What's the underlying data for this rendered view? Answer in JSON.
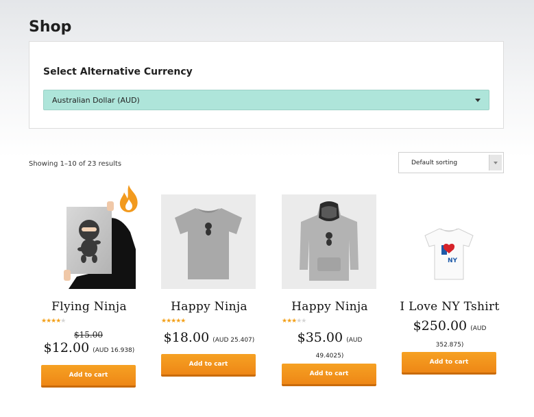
{
  "page": {
    "title": "Shop"
  },
  "currency": {
    "label": "Select Alternative Currency",
    "selected": "Australian Dollar (AUD)"
  },
  "results": {
    "text": "Showing 1–10 of 23 results"
  },
  "sorting": {
    "selected": "Default sorting"
  },
  "products": [
    {
      "name": "Flying Ninja",
      "rating": 4,
      "old_price": "$15.00",
      "price": "$12.00",
      "alt_price": "(AUD 16.938)",
      "button": "Add to cart",
      "hot_icon": "flame-icon"
    },
    {
      "name": "Happy Ninja",
      "rating": 5,
      "price": "$18.00",
      "alt_price": "(AUD 25.407)",
      "button": "Add to cart"
    },
    {
      "name": "Happy Ninja",
      "rating": 3,
      "price": "$35.00",
      "alt_price_1": "(AUD",
      "alt_price_2": "49.4025)",
      "button": "Add to cart"
    },
    {
      "name": "I Love NY Tshirt",
      "price": "$250.00",
      "alt_price_1": "(AUD",
      "alt_price_2": "352.875)",
      "button": "Add to cart"
    }
  ],
  "colors": {
    "accent": "#f39c1f",
    "select_bg": "#aee5da"
  }
}
